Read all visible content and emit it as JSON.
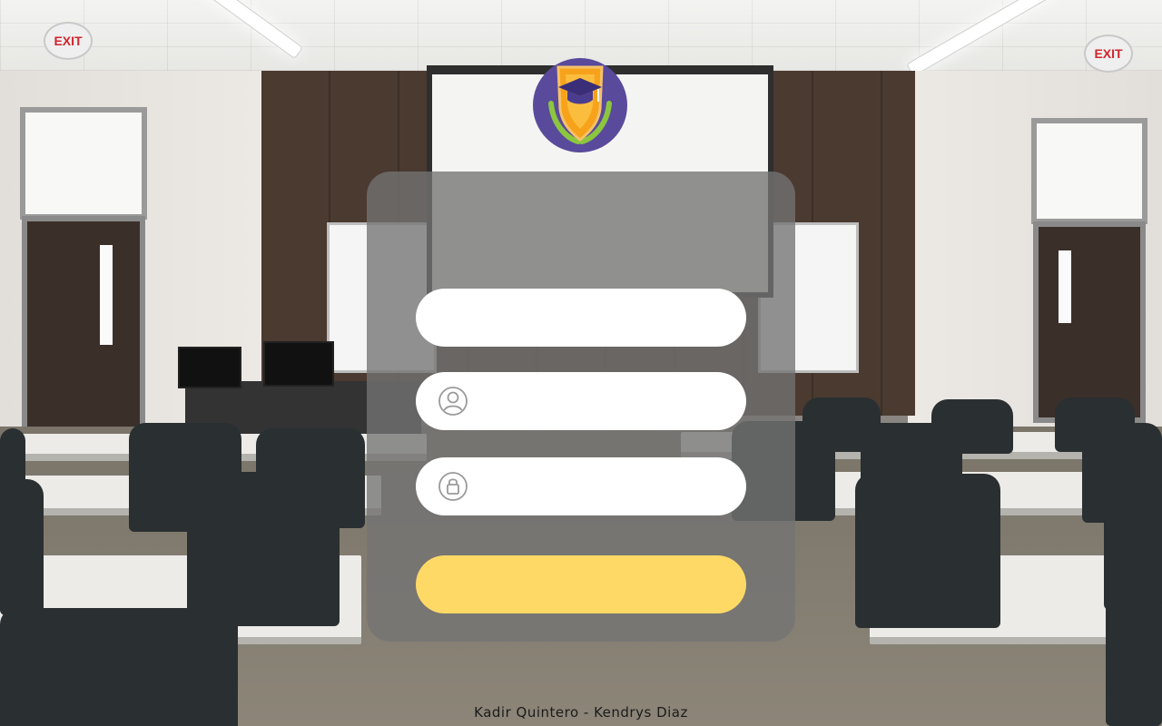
{
  "background": {
    "exit_sign_text": "EXIT"
  },
  "login": {
    "top_field": {
      "value": "",
      "placeholder": ""
    },
    "username_field": {
      "value": "",
      "placeholder": "",
      "icon": "user-circle-icon"
    },
    "password_field": {
      "value": "",
      "placeholder": "",
      "icon": "lock-icon"
    },
    "submit_label": ""
  },
  "logo": {
    "icon": "graduation-shield-logo"
  },
  "footer": {
    "credits": "Kadir Quintero - Kendrys Diaz"
  },
  "colors": {
    "panel": "#737373",
    "field": "#ffffff",
    "button": "#ffd966",
    "logo_shield": "#f7a21b",
    "logo_circle": "#5a4a9c",
    "laurel": "#8cc63f"
  }
}
